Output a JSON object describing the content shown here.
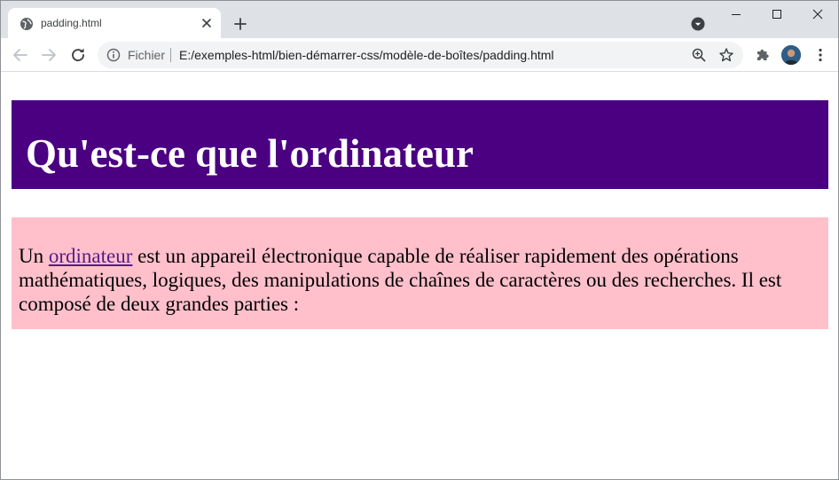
{
  "browser": {
    "tab": {
      "title": "padding.html"
    },
    "address": {
      "scheme_label": "Fichier",
      "url": "E:/exemples-html/bien-démarrer-css/modèle-de-boîtes/padding.html"
    }
  },
  "page": {
    "heading": "Qu'est-ce que l'ordinateur",
    "paragraph": {
      "before_link": "Un ",
      "link_text": "ordinateur",
      "after_link": " est un appareil électronique capable de réaliser rapidement des opérations mathématiques, logiques, des manipulations de chaînes de caractères ou des recherches. Il est composé de deux grandes parties :"
    }
  },
  "colors": {
    "heading_bg": "#4b0082",
    "paragraph_bg": "#ffc0cb",
    "link": "#551a8b"
  }
}
